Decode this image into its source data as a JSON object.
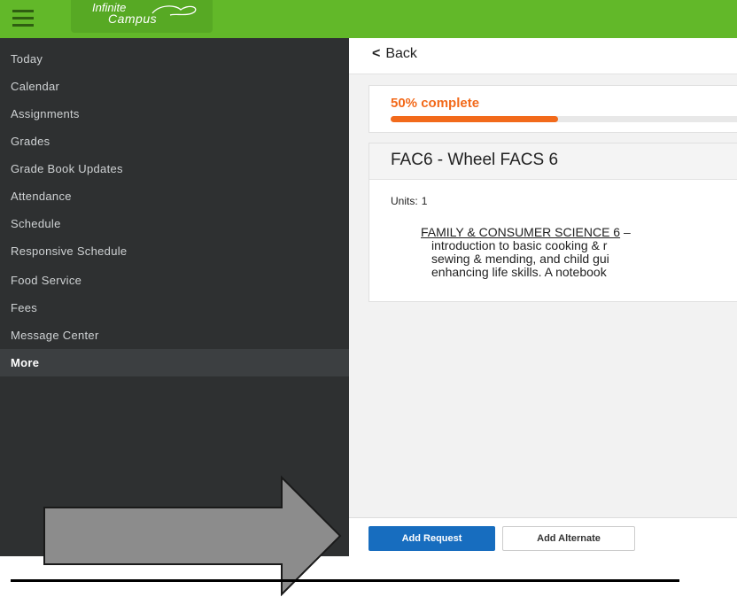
{
  "header": {
    "logo_line1": "Infinite",
    "logo_line2": "Campus",
    "bar_color": "#62b829"
  },
  "sidebar": {
    "items": [
      {
        "label": "Today"
      },
      {
        "label": "Calendar"
      },
      {
        "label": "Assignments"
      },
      {
        "label": "Grades"
      },
      {
        "label": "Grade Book Updates"
      },
      {
        "label": "Attendance"
      },
      {
        "label": "Schedule"
      },
      {
        "label": "Responsive Schedule"
      },
      {
        "label": "Food Service"
      },
      {
        "label": "Fees"
      },
      {
        "label": "Message Center"
      },
      {
        "label": "More",
        "active": true
      }
    ]
  },
  "main": {
    "back_label": "Back",
    "progress": {
      "label": "50% complete",
      "value_percent": 50,
      "color": "#f26a1b"
    },
    "course": {
      "title": "FAC6 - Wheel FACS 6",
      "units_label": "Units:",
      "units_value": "1",
      "desc_code": "FAMILY & CONSUMER SCIENCE 6",
      "desc_dash": " –",
      "desc_line1": "introduction to basic cooking & r",
      "desc_line2": "sewing & mending, and child gui",
      "desc_line3": "enhancing life skills. A notebook"
    }
  },
  "footer": {
    "add_request_label": "Add Request",
    "add_alternate_label": "Add Alternate",
    "primary_color": "#176dbf"
  }
}
